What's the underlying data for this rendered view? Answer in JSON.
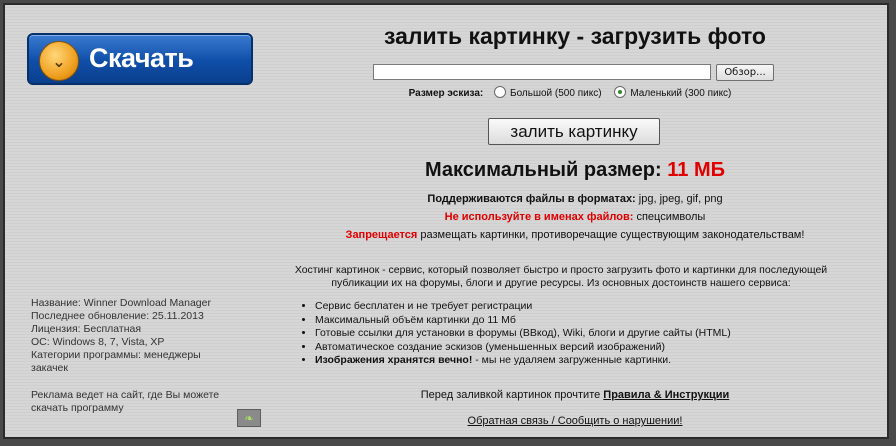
{
  "banner": {
    "label": "Скачать",
    "icon": "double-chevron-down-icon",
    "icon_glyph": "⌄",
    "colors": {
      "bg": "#0f4ea8",
      "icon": "#f0a020"
    }
  },
  "upload": {
    "title": "залить картинку - загрузить фото",
    "browse_label": "Обзор...",
    "thumb_label": "Размер эскиза:",
    "options": [
      {
        "label": "Большой (500 пикс)",
        "selected": false
      },
      {
        "label": "Маленький (300 пикс)",
        "selected": true
      }
    ],
    "submit_label": "залить картинку"
  },
  "limits": {
    "max_label": "Максимальный размер:",
    "max_value": "11 МБ",
    "formats_label": "Поддерживаются файлы в форматах:",
    "formats_value": "jpg, jpeg, gif, png",
    "names_label": "Не используйте в именах файлов:",
    "names_value": "спецсимволы",
    "forbid_label": "Запрещается",
    "forbid_text": "размещать картинки, противоречащие существующим законодательствам!"
  },
  "about": {
    "text": "Хостинг картинок - сервис, который позволяет быстро и просто загрузить фото и картинки для последующей публикации их на форумы, блоги и другие ресурсы. Из основных достоинств нашего сервиса:",
    "features": [
      {
        "text": "Сервис бесплатен и не требует регистрации"
      },
      {
        "text": "Максимальный объём картинки до 11 Мб"
      },
      {
        "text": "Готовые ссылки для установки в форумы (ВВкод), Wiki, блоги и другие сайты (HTML)"
      },
      {
        "text": "Автоматическое создание эскизов (уменьшенных версий изображений)"
      },
      {
        "bold": "Изображения хранятся вечно!",
        "text": " - мы не удаляем загруженные картинки."
      }
    ]
  },
  "footer": {
    "rules_prefix": "Перед заливкой картинок прочтите",
    "rules_link": "Правила & Инструкции",
    "feedback_link": "Обратная связь / Сообщить о нарушении!"
  },
  "program": {
    "name": "Название: Winner Download Manager",
    "updated": "Последнее обновление: 25.11.2013",
    "license": "Лицензия: Бесплатная",
    "os": "ОС: Windows 8, 7, Vista, XP",
    "category": "Категории программы: менеджеры закачек",
    "ad": "Реклама ведет на сайт, где Вы можете скачать программу",
    "badge_icon": "leaf-icon",
    "badge_glyph": "❧"
  }
}
